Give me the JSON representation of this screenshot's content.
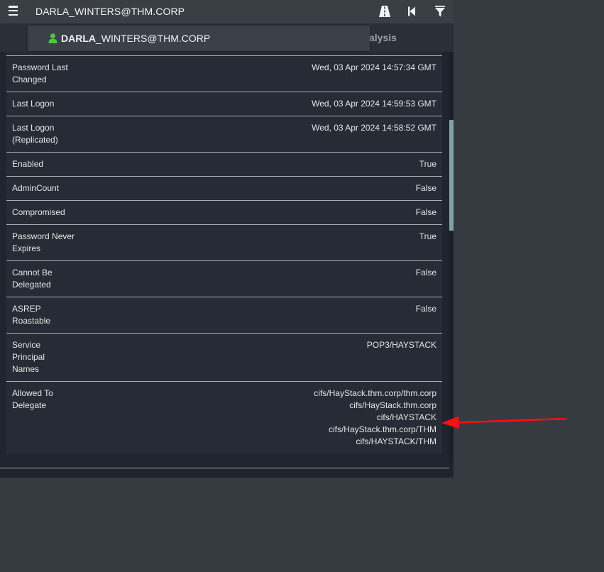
{
  "topbar": {
    "title": "DARLA_WINTERS@THM.CORP"
  },
  "icons": {
    "menu": "menu-icon",
    "pathfinding": "pathfinding-road-icon",
    "back": "back-icon",
    "filter": "filter-icon",
    "user": "user-icon"
  },
  "tabs": {
    "analysis_partial": "alysis"
  },
  "search": {
    "name_bold": "DARLA",
    "name_rest": "_WINTERS@THM.CORP"
  },
  "colors": {
    "user_node": "#4ccb3e",
    "arrow": "#ff1010"
  },
  "properties": [
    {
      "label": "Password Last Changed",
      "value": "Wed, 03 Apr 2024 14:57:34 GMT"
    },
    {
      "label": "Last Logon",
      "value": "Wed, 03 Apr 2024 14:59:53 GMT"
    },
    {
      "label": "Last Logon (Replicated)",
      "value": "Wed, 03 Apr 2024 14:58:52 GMT"
    },
    {
      "label": "Enabled",
      "value": "True"
    },
    {
      "label": "AdminCount",
      "value": "False"
    },
    {
      "label": "Compromised",
      "value": "False"
    },
    {
      "label": "Password Never Expires",
      "value": "True"
    },
    {
      "label": "Cannot Be Delegated",
      "value": "False"
    },
    {
      "label": "ASREP Roastable",
      "value": "False"
    },
    {
      "label": "Service Principal Names",
      "value": "POP3/HAYSTACK"
    },
    {
      "label": "Allowed To Delegate",
      "values": [
        "cifs/HayStack.thm.corp/thm.corp",
        "cifs/HayStack.thm.corp",
        "cifs/HAYSTACK",
        "cifs/HayStack.thm.corp/THM",
        "cifs/HAYSTACK/THM"
      ]
    }
  ]
}
